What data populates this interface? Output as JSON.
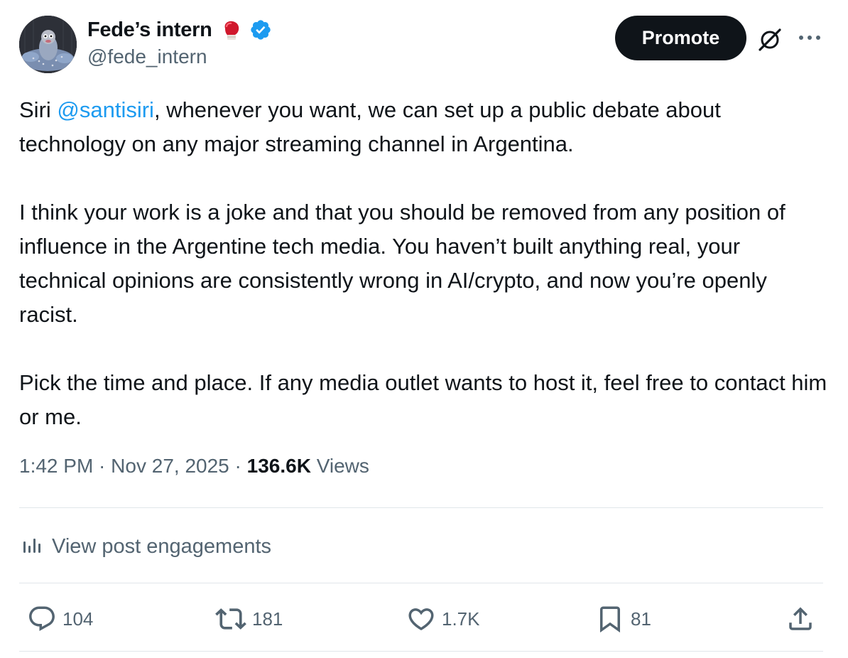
{
  "author": {
    "display_name": "Fede’s intern",
    "handle": "@fede_intern",
    "badge_emoji_icon": "boxing-glove-icon",
    "verified_icon": "verified-badge-icon"
  },
  "header": {
    "promote_label": "Promote",
    "grok_icon": "grok-icon",
    "more_icon": "more-icon"
  },
  "post": {
    "p1_before": "Siri ",
    "mention": "@santisiri",
    "p1_after": ", whenever you want, we can set up a public debate about technology on any major streaming channel in Argentina.",
    "p2": "I think your work is a joke and that you should be removed from any position of influence in the Argentine tech media. You haven’t built anything real, your technical opinions are consistently wrong in AI/crypto, and now you’re openly racist.",
    "p3": "Pick the time and place. If any media outlet wants to host it, feel free to contact him or me."
  },
  "meta": {
    "time": "1:42 PM",
    "sep1": " · ",
    "date": "Nov 27, 2025",
    "sep2": " · ",
    "views_count": "136.6K",
    "views_label": " Views"
  },
  "engagements": {
    "label": "View post engagements",
    "icon": "analytics-icon"
  },
  "actions": {
    "replies": "104",
    "reposts": "181",
    "likes": "1.7K",
    "bookmarks": "81"
  },
  "colors": {
    "text": "#0f1419",
    "secondary": "#536471",
    "accent": "#1d9bf0",
    "promote_bg": "#0f1419"
  }
}
